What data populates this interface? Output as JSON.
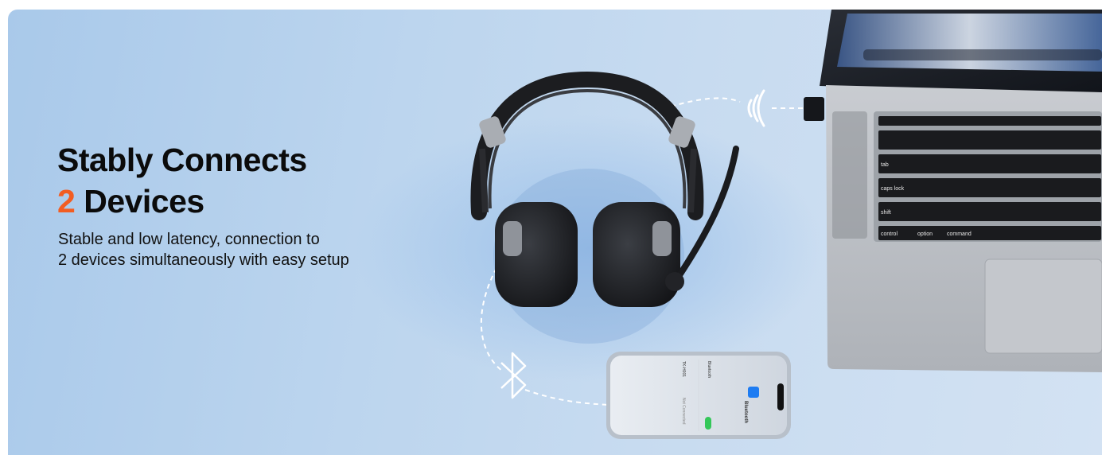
{
  "headline": {
    "line1": "Stably Connects",
    "accent_number": "2",
    "line2_rest": " Devices"
  },
  "subheadline": {
    "line1": "Stable and low latency, connection to",
    "line2": "2 devices simultaneously with easy setup"
  },
  "keyboard_labels": {
    "tab": "tab",
    "caps": "caps lock",
    "shift": "shift",
    "control": "control",
    "option": "option",
    "command": "command"
  },
  "phone_screen": {
    "title": "Bluetooth",
    "setting": "Bluetooth",
    "device": "TK-H001",
    "status": "Not Connected"
  },
  "colors": {
    "accent": "#f25d22",
    "background": "#bcd5ee",
    "headline_text": "#0b0b0b"
  }
}
